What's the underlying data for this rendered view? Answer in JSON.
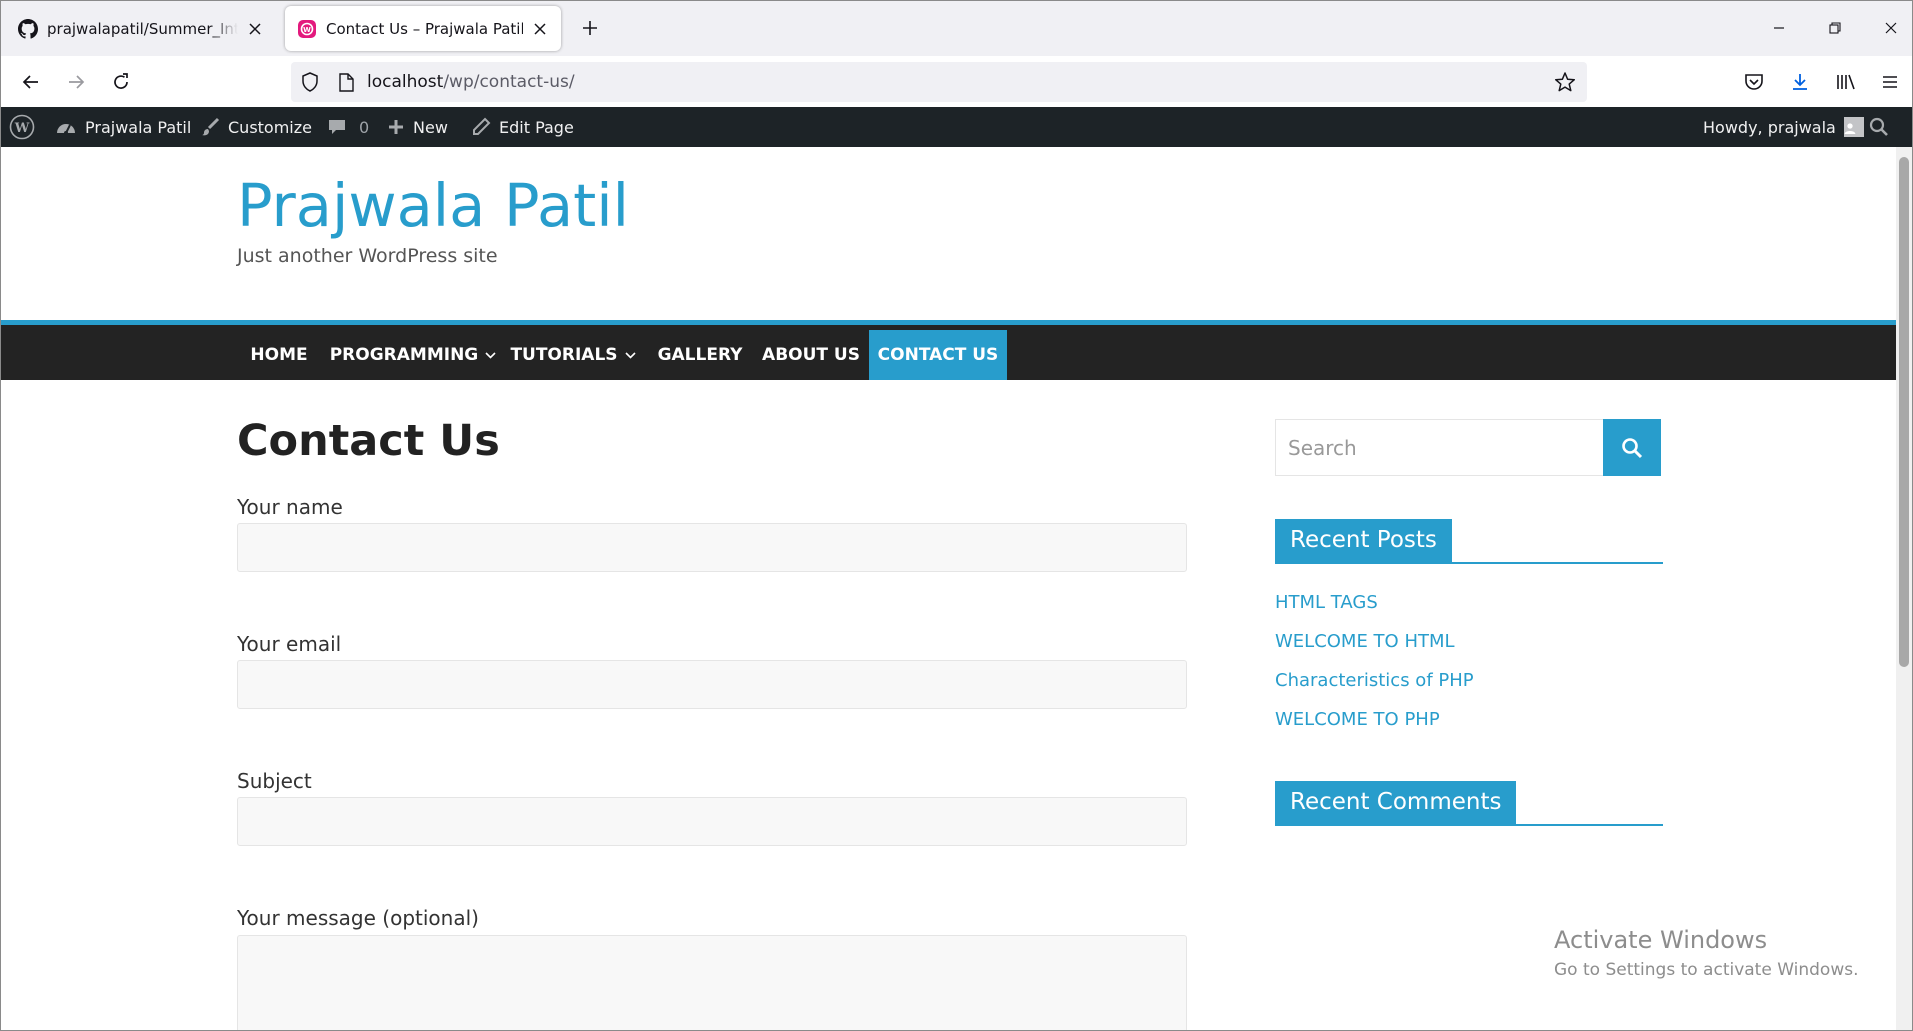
{
  "browser": {
    "tabs": [
      {
        "title": "prajwalapatil/Summer_Internship",
        "icon": "github-icon",
        "active": false
      },
      {
        "title": "Contact Us – Prajwala Patil",
        "icon": "wordpress-tab-icon",
        "active": true
      }
    ],
    "url_host": "localhost",
    "url_path": "/wp/contact-us/"
  },
  "adminbar": {
    "site_name": "Prajwala Patil",
    "customize": "Customize",
    "comments_count": "0",
    "new_label": "New",
    "edit_page": "Edit Page",
    "howdy": "Howdy, prajwala"
  },
  "site": {
    "title": "Prajwala Patil",
    "description": "Just another WordPress site"
  },
  "menu": {
    "items": [
      {
        "label": "HOME",
        "dropdown": false
      },
      {
        "label": "PROGRAMMING",
        "dropdown": true
      },
      {
        "label": "TUTORIALS",
        "dropdown": true
      },
      {
        "label": "GALLERY",
        "dropdown": false
      },
      {
        "label": "ABOUT US",
        "dropdown": false
      },
      {
        "label": "CONTACT US",
        "dropdown": false,
        "current": true
      }
    ]
  },
  "content": {
    "page_title": "Contact Us",
    "form": {
      "name_label": "Your name",
      "email_label": "Your email",
      "subject_label": "Subject",
      "message_label": "Your message (optional)"
    }
  },
  "sidebar": {
    "search_placeholder": "Search",
    "recent_posts_title": "Recent Posts",
    "recent_posts": [
      "HTML TAGS",
      "WELCOME TO HTML",
      "Characteristics of PHP",
      "WELCOME TO PHP"
    ],
    "recent_comments_title": "Recent Comments"
  },
  "watermark": {
    "line1": "Activate Windows",
    "line2": "Go to Settings to activate Windows."
  },
  "colors": {
    "accent": "#289dcc",
    "adminbar": "#1d2327",
    "menubar": "#232323"
  }
}
